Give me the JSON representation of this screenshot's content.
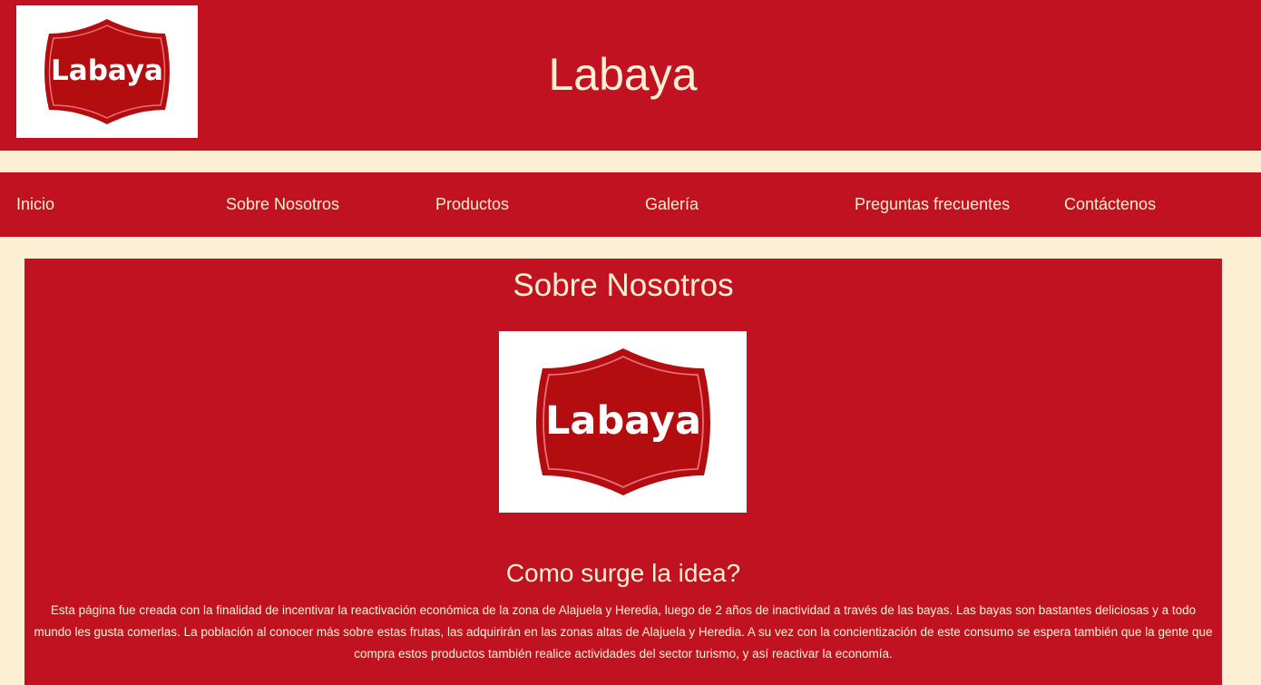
{
  "brand": {
    "logo_text": "Labaya",
    "site_title": "Labaya"
  },
  "nav": {
    "items": [
      {
        "label": "Inicio"
      },
      {
        "label": "Sobre Nosotros"
      },
      {
        "label": "Productos"
      },
      {
        "label": "Galería"
      },
      {
        "label": "Preguntas frecuentes"
      },
      {
        "label": "Contáctenos"
      }
    ]
  },
  "main": {
    "title": "Sobre Nosotros",
    "subtitle": "Como surge la idea?",
    "paragraph": "Esta página fue creada con la finalidad de incentivar la reactivación económica de la zona de Alajuela y Heredia, luego de 2 años de inactividad a través de las bayas. Las bayas son bastantes deliciosas y a todo mundo les gusta comerlas. La población al conocer más sobre estas frutas, las adquirirán en las zonas altas de Alajuela y Heredia. A su vez con la concientización de este consumo se espera también que la gente que compra estos productos también realice actividades del sector turismo, y así reactivar la economía."
  },
  "colors": {
    "brand_red": "#c01221",
    "logo_red": "#b30d10",
    "cream": "#fcefd4",
    "white": "#ffffff"
  }
}
